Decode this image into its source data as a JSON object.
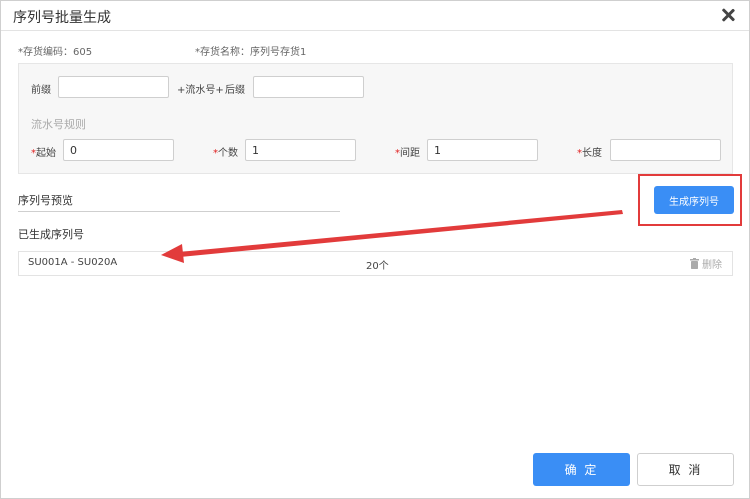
{
  "dialog": {
    "title": "序列号批量生成"
  },
  "info": {
    "code_label": "*存货编码：605",
    "name_label": "*存货名称：序列号存货1"
  },
  "form": {
    "prefix_label": "前缀",
    "prefix_value": "",
    "serial_connector": "+流水号+",
    "suffix_label": "后缀",
    "suffix_value": "",
    "rule_title": "流水号规则",
    "required_mark": "*",
    "start_label": "起始",
    "start_value": "0",
    "count_label": "个数",
    "count_value": "1",
    "step_label": "间距",
    "step_value": "1",
    "length_label": "长度",
    "length_value": ""
  },
  "preview": {
    "title": "序列号预览",
    "generate_button": "生成序列号"
  },
  "generated": {
    "title": "已生成序列号",
    "rows": [
      {
        "range": "SU001A - SU020A",
        "count": "20个",
        "delete_label": "删除"
      }
    ]
  },
  "footer": {
    "ok_label": "确 定",
    "cancel_label": "取 消"
  },
  "colors": {
    "primary": "#3a8ef5",
    "highlight": "#e23b3b",
    "required": "#e02020"
  },
  "icons": [
    "close-icon",
    "trash-icon",
    "arrow-annotation"
  ]
}
